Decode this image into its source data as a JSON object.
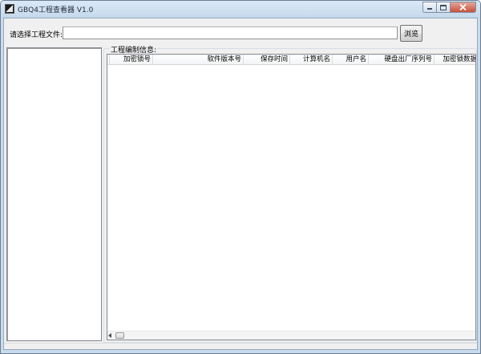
{
  "window": {
    "title": "GBQ4工程查看器 V1.0",
    "frame_color": "#c9dcee",
    "close_color": "#c7503a"
  },
  "toolbar": {
    "file_label": "请选择工程文件:",
    "file_value": "",
    "browse_label": "浏览"
  },
  "info_group": {
    "label": "工程编制信息:",
    "columns": [
      "加密锁号",
      "软件版本号",
      "保存时间",
      "计算机名",
      "用户名",
      "硬盘出厂序列号",
      "加密锁数据"
    ],
    "rows": []
  },
  "icons": {
    "app": "app-icon",
    "minimize": "minimize-icon",
    "maximize": "maximize-icon",
    "close": "close-icon",
    "scroll_left": "arrow-left-icon"
  }
}
